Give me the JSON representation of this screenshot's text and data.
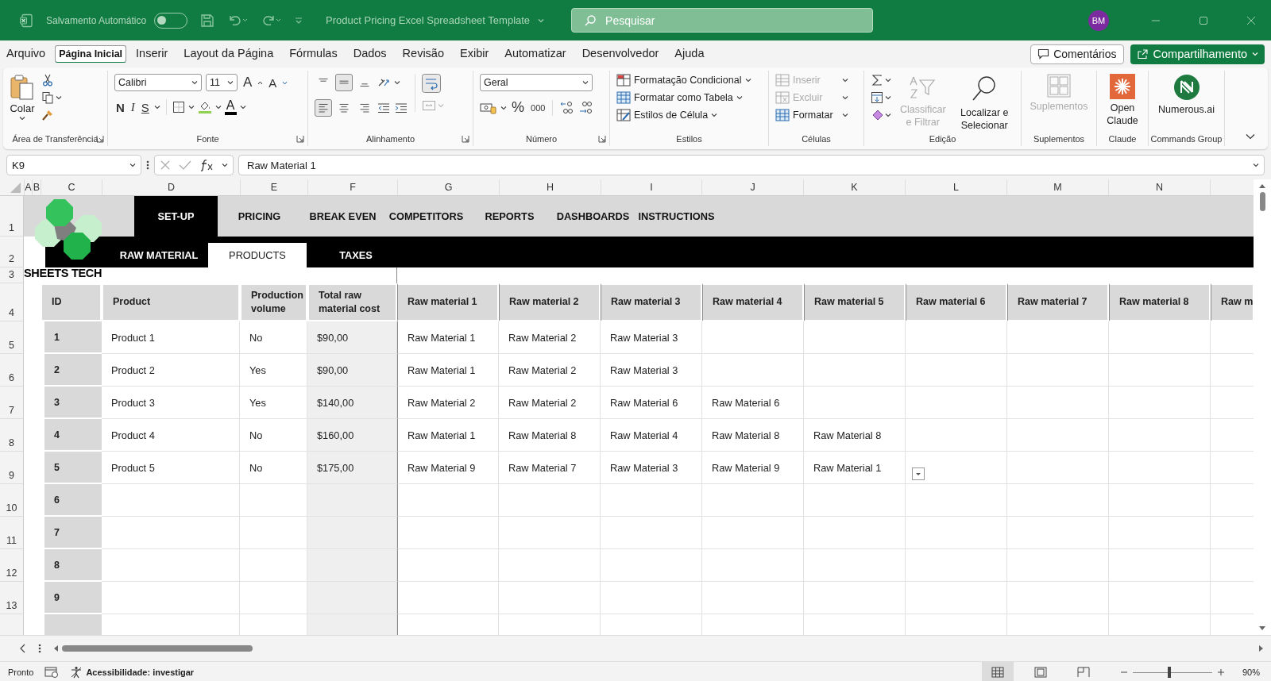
{
  "titlebar": {
    "autosave_label": "Salvamento Automático",
    "autosave_on": false,
    "doc_title": "Product Pricing Excel Spreadsheet Template",
    "search_placeholder": "Pesquisar",
    "avatar": "BM"
  },
  "menu": [
    {
      "label": "Arquivo",
      "selected": false
    },
    {
      "label": "Página Inicial",
      "selected": true
    },
    {
      "label": "Inserir",
      "selected": false
    },
    {
      "label": "Layout da Página",
      "selected": false
    },
    {
      "label": "Fórmulas",
      "selected": false
    },
    {
      "label": "Dados",
      "selected": false
    },
    {
      "label": "Revisão",
      "selected": false
    },
    {
      "label": "Exibir",
      "selected": false
    },
    {
      "label": "Automatizar",
      "selected": false
    },
    {
      "label": "Desenvolvedor",
      "selected": false
    },
    {
      "label": "Ajuda",
      "selected": false
    }
  ],
  "comments_button": "Comentários",
  "share_button": "Compartilhamento",
  "ribbon": {
    "clipboard": {
      "paste": "Colar",
      "label": "Área de Transferência"
    },
    "font": {
      "family": "Calibri",
      "size": "11",
      "grow": "A",
      "shrink": "A",
      "bold": "N",
      "italic": "I",
      "underline": "S",
      "color_letter": "A",
      "label": "Fonte"
    },
    "alignment": {
      "vertical": [
        {
          "kind": "top",
          "selected": false
        },
        {
          "kind": "middle",
          "selected": true
        },
        {
          "kind": "bottom",
          "selected": false
        }
      ],
      "horizontal": [
        {
          "kind": "left",
          "selected": true
        },
        {
          "kind": "center",
          "selected": false
        },
        {
          "kind": "right",
          "selected": false
        }
      ],
      "label": "Alinhamento"
    },
    "number": {
      "format": "Geral",
      "percent": "%",
      "thousands": "000",
      "label": "Número"
    },
    "styles": {
      "items": [
        {
          "kind": "conditional",
          "label": "Formatação Condicional"
        },
        {
          "kind": "table",
          "label": "Formatar como Tabela"
        },
        {
          "kind": "cell",
          "label": "Estilos de Célula"
        }
      ],
      "label": "Estilos"
    },
    "cells": {
      "items": [
        {
          "kind": "insert",
          "label": "Inserir",
          "disabled": true
        },
        {
          "kind": "delete",
          "label": "Excluir",
          "disabled": true
        },
        {
          "kind": "format",
          "label": "Formatar",
          "disabled": false
        }
      ],
      "label": "Células"
    },
    "editing": {
      "sort": {
        "label": "Classificar e Filtrar",
        "disabled": true
      },
      "find": "Localizar e Selecionar",
      "label": "Edição"
    },
    "addins": {
      "button": "Suplementos",
      "disabled": true,
      "label": "Suplementos"
    },
    "claude": {
      "button": "Open Claude",
      "label": "Claude"
    },
    "commands": {
      "button": "Numerous.ai",
      "label": "Commands Group"
    }
  },
  "formula_bar": {
    "name_box": "K9",
    "formula": "Raw Material 1"
  },
  "columns": [
    "A",
    "B",
    "C",
    "D",
    "E",
    "F",
    "G",
    "H",
    "I",
    "J",
    "K",
    "L",
    "M",
    "N"
  ],
  "sheet": {
    "banner_rows": [
      "1",
      "2",
      "3"
    ],
    "header_row": "4",
    "nav": [
      {
        "label": "SET-UP",
        "selected": true
      },
      {
        "label": "PRICING",
        "selected": false
      },
      {
        "label": "BREAK EVEN",
        "selected": false
      },
      {
        "label": "COMPETITORS",
        "selected": false
      },
      {
        "label": "REPORTS",
        "selected": false
      },
      {
        "label": "DASHBOARDS",
        "selected": false
      },
      {
        "label": "INSTRUCTIONS",
        "selected": false
      }
    ],
    "subnav": [
      {
        "label": "RAW MATERIAL",
        "selected": false
      },
      {
        "label": "PRODUCTS",
        "selected": true
      },
      {
        "label": "TAXES",
        "selected": false
      }
    ],
    "brand": "SHEETS TECH",
    "headers": [
      "ID",
      "Product",
      "Production volume",
      "Total raw material cost",
      "Raw material 1",
      "Raw material 2",
      "Raw material 3",
      "Raw material 4",
      "Raw material 5",
      "Raw material 6",
      "Raw material 7",
      "Raw material 8",
      "Raw m"
    ],
    "rows": [
      {
        "row": "5",
        "id": "1",
        "product": "Product 1",
        "volume": "No",
        "cost": "$90,00",
        "materials": [
          "Raw Material 1",
          "Raw Material 2",
          "Raw Material 3"
        ]
      },
      {
        "row": "6",
        "id": "2",
        "product": "Product 2",
        "volume": "Yes",
        "cost": "$90,00",
        "materials": [
          "Raw Material 1",
          "Raw Material 2",
          "Raw Material 3"
        ]
      },
      {
        "row": "7",
        "id": "3",
        "product": "Product 3",
        "volume": "Yes",
        "cost": "$140,00",
        "materials": [
          "Raw Material 2",
          "Raw Material 2",
          "Raw Material 6",
          "Raw Material 6"
        ]
      },
      {
        "row": "8",
        "id": "4",
        "product": "Product 4",
        "volume": "No",
        "cost": "$160,00",
        "materials": [
          "Raw Material 1",
          "Raw Material 8",
          "Raw Material 4",
          "Raw Material 8",
          "Raw Material 8"
        ]
      },
      {
        "row": "9",
        "id": "5",
        "product": "Product 5",
        "volume": "No",
        "cost": "$175,00",
        "materials": [
          "Raw Material 9",
          "Raw Material 7",
          "Raw Material 3",
          "Raw Material 9",
          "Raw Material 1"
        ],
        "dropdown": true
      },
      {
        "row": "10",
        "id": "6",
        "product": "",
        "volume": "",
        "cost": "",
        "materials": []
      },
      {
        "row": "11",
        "id": "7",
        "product": "",
        "volume": "",
        "cost": "",
        "materials": []
      },
      {
        "row": "12",
        "id": "8",
        "product": "",
        "volume": "",
        "cost": "",
        "materials": []
      },
      {
        "row": "13",
        "id": "9",
        "product": "",
        "volume": "",
        "cost": "",
        "materials": []
      }
    ]
  },
  "status": {
    "ready": "Pronto",
    "accessibility": "Acessibilidade: investigar",
    "views": [
      {
        "kind": "normal",
        "selected": true
      },
      {
        "kind": "layout",
        "selected": false
      },
      {
        "kind": "pagebreak",
        "selected": false
      }
    ],
    "zoom_slider": {
      "level": 0.46
    },
    "zoom": "90%"
  }
}
